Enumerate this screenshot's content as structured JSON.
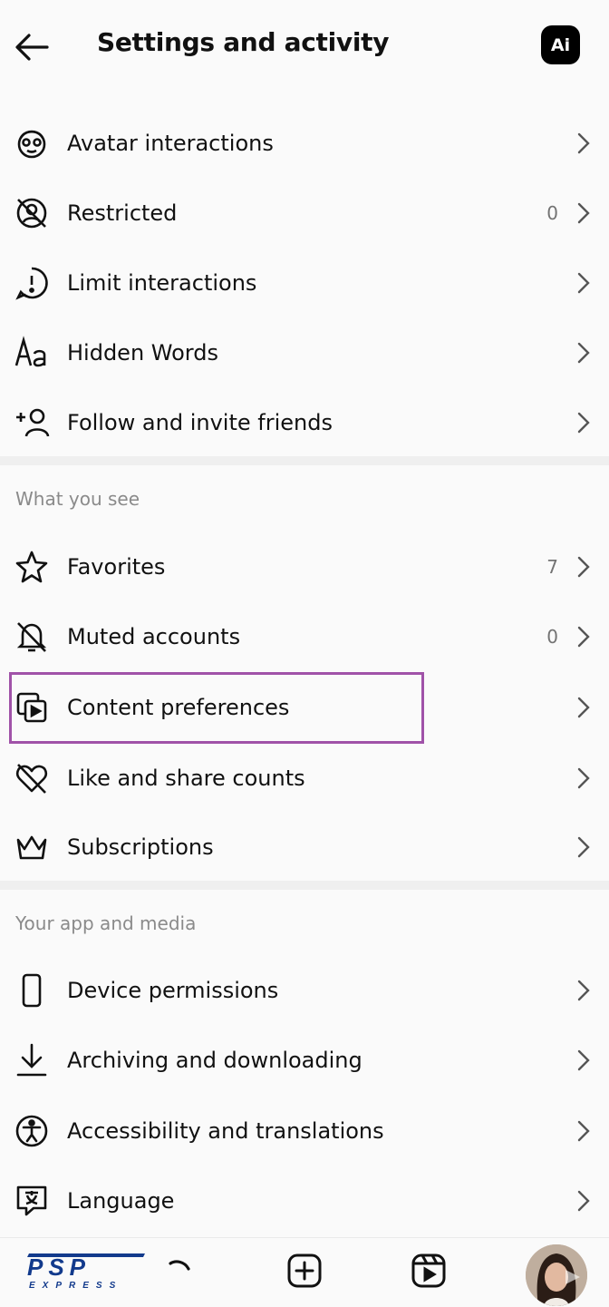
{
  "header": {
    "title": "Settings and activity",
    "ai_badge": "Ai"
  },
  "interactions": [
    {
      "label": "Avatar interactions",
      "icon": "avatar-face-icon",
      "count": ""
    },
    {
      "label": "Restricted",
      "icon": "restricted-icon",
      "count": "0"
    },
    {
      "label": "Limit interactions",
      "icon": "limit-interactions-icon",
      "count": ""
    },
    {
      "label": "Hidden Words",
      "icon": "hidden-words-icon",
      "count": ""
    },
    {
      "label": "Follow and invite friends",
      "icon": "add-person-icon",
      "count": ""
    }
  ],
  "what_you_see": {
    "heading": "What you see",
    "items": [
      {
        "label": "Favorites",
        "icon": "star-icon",
        "count": "7"
      },
      {
        "label": "Muted accounts",
        "icon": "muted-bell-icon",
        "count": "0"
      },
      {
        "label": "Content preferences",
        "icon": "content-preferences-icon",
        "count": "",
        "highlighted": true
      },
      {
        "label": "Like and share counts",
        "icon": "heart-slash-icon",
        "count": ""
      },
      {
        "label": "Subscriptions",
        "icon": "crown-icon",
        "count": ""
      }
    ]
  },
  "app_media": {
    "heading": "Your app and media",
    "items": [
      {
        "label": "Device permissions",
        "icon": "phone-icon",
        "count": ""
      },
      {
        "label": "Archiving and downloading",
        "icon": "download-icon",
        "count": ""
      },
      {
        "label": "Accessibility and translations",
        "icon": "accessibility-icon",
        "count": ""
      },
      {
        "label": "Language",
        "icon": "language-icon",
        "count": ""
      }
    ]
  },
  "bottom_nav": {
    "tabs": [
      "search-icon",
      "create-icon",
      "reels-icon",
      "profile-avatar"
    ]
  },
  "watermark": {
    "text": "PSP EXPRESS"
  },
  "colors": {
    "highlight": "#a052a8",
    "muted_text": "#8a8a8a",
    "count_text": "#737373"
  }
}
